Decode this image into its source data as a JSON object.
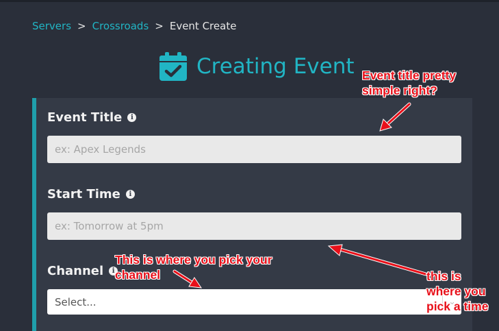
{
  "breadcrumb": {
    "items": [
      "Servers",
      "Crossroads",
      "Event Create"
    ],
    "separator": ">"
  },
  "page": {
    "title": "Creating Event",
    "title_icon": "calendar-check-icon"
  },
  "form": {
    "event_title": {
      "label": "Event Title",
      "info_glyph": "i",
      "placeholder": "ex: Apex Legends",
      "value": ""
    },
    "start_time": {
      "label": "Start Time",
      "info_glyph": "i",
      "placeholder": "ex: Tomorrow at 5pm",
      "value": ""
    },
    "channel": {
      "label": "Channel",
      "info_glyph": "i",
      "selected": "Select..."
    }
  },
  "annotations": {
    "title_note": [
      "Event title pretty",
      "simple right?"
    ],
    "channel_note": [
      "This is where you pick your",
      "channel"
    ],
    "time_note": [
      "this is",
      "where you",
      "pick a time"
    ]
  },
  "colors": {
    "background": "#2a2f3a",
    "card": "#343a46",
    "accent": "#21b5c4",
    "annotation": "#e8101a"
  }
}
